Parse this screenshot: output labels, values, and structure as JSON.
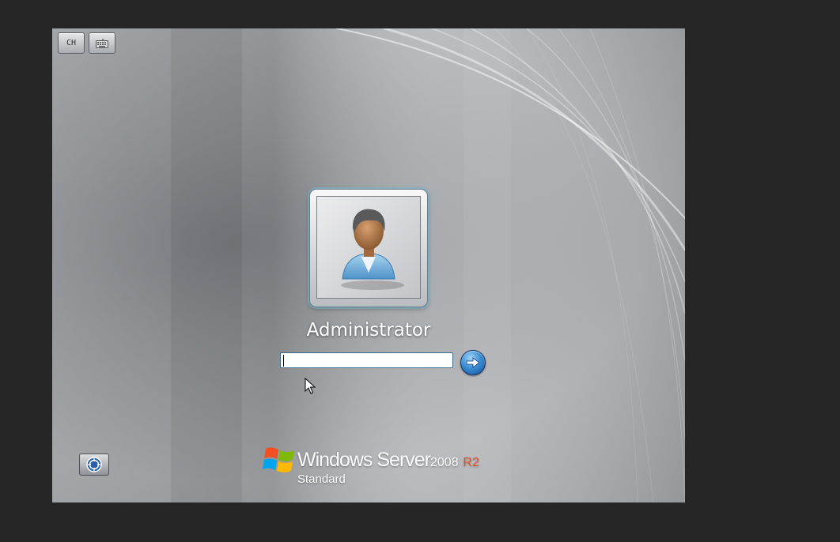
{
  "toolbar": {
    "language_label": "CH",
    "keyboard_icon": "keyboard-icon"
  },
  "user": {
    "name": "Administrator",
    "avatar_icon": "user-avatar-icon"
  },
  "password": {
    "value": "",
    "placeholder": ""
  },
  "submit": {
    "icon": "arrow-right-icon"
  },
  "ease_of_access": {
    "icon": "ease-of-access-icon"
  },
  "branding": {
    "product_name": "Windows Server",
    "version": "2008",
    "release": "R2",
    "edition": "Standard",
    "logo_icon": "windows-flag-icon"
  },
  "colors": {
    "outer_background": "#262626",
    "accent_release": "#e8532c",
    "submit_button": "#3b8fd4"
  }
}
